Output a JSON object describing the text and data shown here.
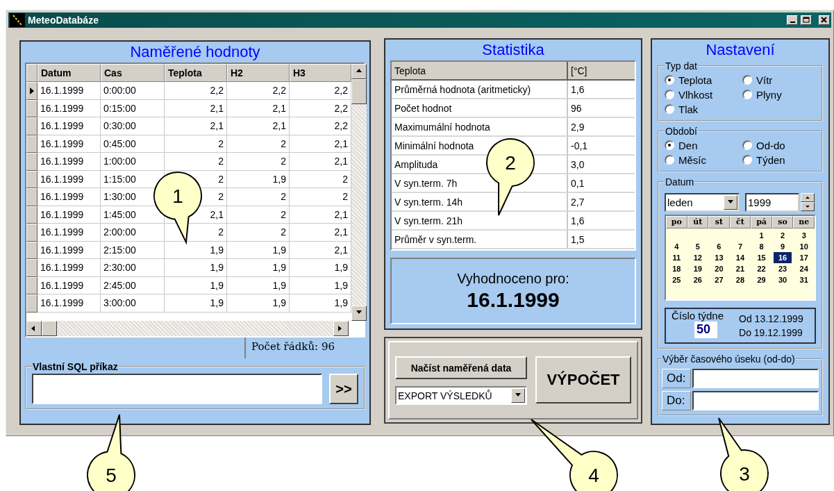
{
  "window": {
    "title": "MeteoDatabáze"
  },
  "measured": {
    "title": "Naměřené hodnoty",
    "columns": [
      "Datum",
      "Cas",
      "Teplota",
      "H2",
      "H3"
    ],
    "rows": [
      {
        "current": true,
        "cells": [
          "16.1.1999",
          "0:00:00",
          "2,2",
          "2,2",
          "2,2"
        ]
      },
      {
        "current": false,
        "cells": [
          "16.1.1999",
          "0:15:00",
          "2,1",
          "2,1",
          "2,2"
        ]
      },
      {
        "current": false,
        "cells": [
          "16.1.1999",
          "0:30:00",
          "2,1",
          "2,1",
          "2,2"
        ]
      },
      {
        "current": false,
        "cells": [
          "16.1.1999",
          "0:45:00",
          "2",
          "2",
          "2,1"
        ]
      },
      {
        "current": false,
        "cells": [
          "16.1.1999",
          "1:00:00",
          "2",
          "2",
          "2,1"
        ]
      },
      {
        "current": false,
        "cells": [
          "16.1.1999",
          "1:15:00",
          "2",
          "1,9",
          "2"
        ]
      },
      {
        "current": false,
        "cells": [
          "16.1.1999",
          "1:30:00",
          "2",
          "2",
          "2"
        ]
      },
      {
        "current": false,
        "cells": [
          "16.1.1999",
          "1:45:00",
          "2,1",
          "2",
          "2,1"
        ]
      },
      {
        "current": false,
        "cells": [
          "16.1.1999",
          "2:00:00",
          "2",
          "2",
          "2,1"
        ]
      },
      {
        "current": false,
        "cells": [
          "16.1.1999",
          "2:15:00",
          "1,9",
          "1,9",
          "2,1"
        ]
      },
      {
        "current": false,
        "cells": [
          "16.1.1999",
          "2:30:00",
          "1,9",
          "1,9",
          "1,9"
        ]
      },
      {
        "current": false,
        "cells": [
          "16.1.1999",
          "2:45:00",
          "1,9",
          "1,9",
          "1,9"
        ]
      },
      {
        "current": false,
        "cells": [
          "16.1.1999",
          "3:00:00",
          "1,9",
          "1,9",
          "1,9"
        ]
      }
    ],
    "row_count": "Počet řádků: 96",
    "sql": {
      "legend": "Vlastní SQL příkaz",
      "button": ">>"
    }
  },
  "statistics": {
    "title": "Statistika",
    "columns": [
      "Teplota",
      "[°C]"
    ],
    "rows": [
      {
        "label": "Průměrná hodnota (aritmeticky)",
        "value": "1,6"
      },
      {
        "label": "Počet hodnot",
        "value": "96"
      },
      {
        "label": "Maximumální hodnota",
        "value": "2,9"
      },
      {
        "label": "Minimální hodnota",
        "value": "-0,1"
      },
      {
        "label": "Amplituda",
        "value": "3,0"
      },
      {
        "label": "V syn.term. 7h",
        "value": "0,1"
      },
      {
        "label": "V syn.term. 14h",
        "value": "2,7"
      },
      {
        "label": "V syn.term. 21h",
        "value": "1,6"
      },
      {
        "label": "Průměr v syn.term.",
        "value": "1,5"
      }
    ],
    "evaluated_label": "Vyhodnoceno pro:",
    "evaluated_date": "16.1.1999"
  },
  "actions": {
    "load_button": "Načíst naměřená data",
    "export_select": "EXPORT VÝSLEDKŮ",
    "compute_button": "VÝPOČET"
  },
  "settings": {
    "title": "Nastavení",
    "data_type": {
      "legend": "Typ dat",
      "options": [
        {
          "label": "Teplota",
          "selected": true
        },
        {
          "label": "Vítr",
          "selected": false
        },
        {
          "label": "Vlhkost",
          "selected": false
        },
        {
          "label": "Plyny",
          "selected": false
        },
        {
          "label": "Tlak",
          "selected": false
        }
      ]
    },
    "period": {
      "legend": "Období",
      "options": [
        {
          "label": "Den",
          "selected": true
        },
        {
          "label": "Od-do",
          "selected": false
        },
        {
          "label": "Měsíc",
          "selected": false
        },
        {
          "label": "Týden",
          "selected": false
        }
      ]
    },
    "date": {
      "legend": "Datum",
      "month": "leden",
      "year": "1999",
      "weekdays": [
        "po",
        "út",
        "st",
        "čt",
        "pá",
        "so",
        "ne"
      ],
      "weeks": [
        [
          {
            "kind": "blank"
          },
          {
            "kind": "blank"
          },
          {
            "kind": "blank"
          },
          {
            "kind": "blank"
          },
          {
            "day": "1",
            "selected": false
          },
          {
            "day": "2",
            "selected": false
          },
          {
            "day": "3",
            "selected": false
          }
        ],
        [
          {
            "day": "4",
            "selected": false
          },
          {
            "day": "5",
            "selected": false
          },
          {
            "day": "6",
            "selected": false
          },
          {
            "day": "7",
            "selected": false
          },
          {
            "day": "8",
            "selected": false
          },
          {
            "day": "9",
            "selected": false
          },
          {
            "day": "10",
            "selected": false
          }
        ],
        [
          {
            "day": "11",
            "selected": false
          },
          {
            "day": "12",
            "selected": false
          },
          {
            "day": "13",
            "selected": false
          },
          {
            "day": "14",
            "selected": false
          },
          {
            "day": "15",
            "selected": false
          },
          {
            "day": "16",
            "selected": true
          },
          {
            "day": "17",
            "selected": false
          }
        ],
        [
          {
            "day": "18",
            "selected": false
          },
          {
            "day": "19",
            "selected": false
          },
          {
            "day": "20",
            "selected": false
          },
          {
            "day": "21",
            "selected": false
          },
          {
            "day": "22",
            "selected": false
          },
          {
            "day": "23",
            "selected": false
          },
          {
            "day": "24",
            "selected": false
          }
        ],
        [
          {
            "day": "25",
            "selected": false
          },
          {
            "day": "26",
            "selected": false
          },
          {
            "day": "27",
            "selected": false
          },
          {
            "day": "28",
            "selected": false
          },
          {
            "day": "29",
            "selected": false
          },
          {
            "day": "30",
            "selected": false
          },
          {
            "day": "31",
            "selected": false
          }
        ]
      ]
    },
    "week": {
      "legend": "Číslo týdne",
      "number": "50",
      "from": "Od 13.12.1999",
      "to": "Do 19.12.1999"
    },
    "range": {
      "legend": "Výběr časového úseku (od-do)",
      "from_label": "Od:",
      "to_label": "Do:"
    }
  },
  "callouts": [
    "1",
    "2",
    "5",
    "4",
    "3"
  ]
}
